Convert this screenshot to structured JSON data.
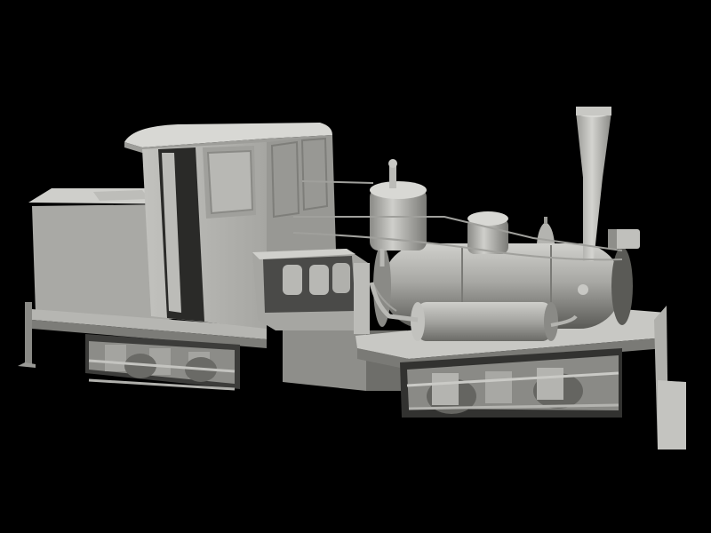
{
  "scene": {
    "subject": "steam-locomotive-3d-render",
    "background_color": "#000000",
    "model_color": "#b8b8b4",
    "shadow_color": "#5c5c58",
    "highlight_color": "#d6d6d2"
  }
}
